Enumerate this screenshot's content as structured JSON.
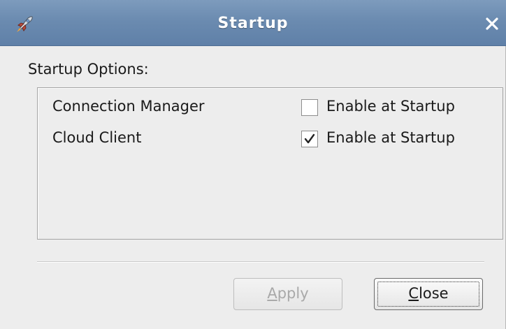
{
  "window": {
    "title": "Startup"
  },
  "section": {
    "label": "Startup Options:"
  },
  "options": [
    {
      "name": "Connection Manager",
      "checkbox_label": "Enable at Startup",
      "checked": false
    },
    {
      "name": "Cloud Client",
      "checkbox_label": "Enable at Startup",
      "checked": true
    }
  ],
  "buttons": {
    "apply": {
      "mnemonic": "A",
      "rest": "pply",
      "enabled": false
    },
    "close": {
      "mnemonic": "C",
      "rest": "lose",
      "enabled": true
    }
  },
  "colors": {
    "titlebar": "#6b8bb0",
    "background": "#ededed",
    "disabled_text": "#a9a9a9"
  },
  "icons": {
    "window_icon": "rocket-icon",
    "close_icon": "close-icon",
    "check_icon": "checkmark-icon"
  }
}
